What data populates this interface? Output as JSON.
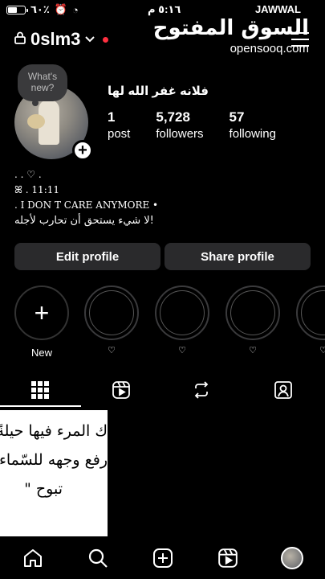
{
  "status_bar": {
    "battery_text": "٦٠٪",
    "battery_level": 0.6,
    "time": "٥:١٦ م",
    "carrier": "JAWWAL"
  },
  "watermark": {
    "arabic": "السوق المفتوح",
    "english": "opensooq.com"
  },
  "header": {
    "username": "0slm3",
    "lock_icon": "lock-icon",
    "dropdown_icon": "chevron-down-icon",
    "menu_icon": "hamburger-menu-icon"
  },
  "profile": {
    "note_text": "What's new?",
    "display_name": "فلانه غفر الله لها",
    "stats": [
      {
        "num": "1",
        "label": "post"
      },
      {
        "num": "5,728",
        "label": "followers"
      },
      {
        "num": "57",
        "label": "following"
      }
    ]
  },
  "bio": {
    "line1": ". . ♡ .",
    "line2": "ꕤ . 11:11",
    "line3": ". I DON T CARE ANYMORE •",
    "line4": "لا شيء يستحق أن تحارب لأجله!"
  },
  "buttons": {
    "edit": "Edit profile",
    "share": "Share profile"
  },
  "highlights": {
    "new_label": "New",
    "heart": "♡"
  },
  "tabs": [
    "grid-icon",
    "reels-icon",
    "reposts-icon",
    "tagged-icon"
  ],
  "post": {
    "line1": "ك المرء فيها حيلةً",
    "line2": "رفع وجهه للسّماء",
    "line3": "تبوح \""
  },
  "nav": [
    "home-icon",
    "search-icon",
    "create-icon",
    "reels-icon",
    "profile-avatar"
  ],
  "colors": {
    "background": "#000000",
    "button": "#2a2a2c",
    "notification_dot": "#ff3040"
  }
}
